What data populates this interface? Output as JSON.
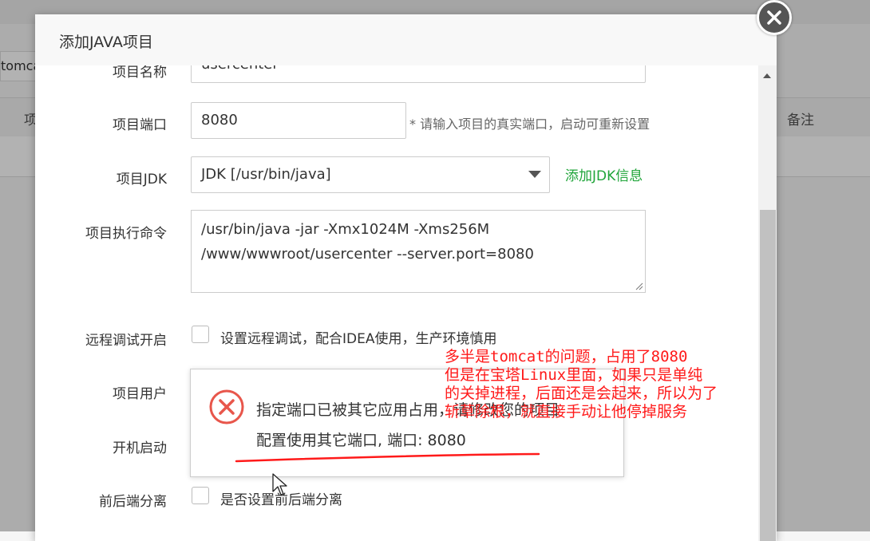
{
  "background": {
    "filter_value": "tomcat",
    "table_headers": [
      "项",
      "备注"
    ]
  },
  "dialog": {
    "title": "添加JAVA项目",
    "fields": {
      "project_name": {
        "label": "项目名称",
        "value": "usercenter"
      },
      "project_port": {
        "label": "项目端口",
        "value": "8080",
        "hint": "* 请输入项目的真实端口，启动可重新设置"
      },
      "project_jdk": {
        "label": "项目JDK",
        "value": "JDK [/usr/bin/java]",
        "add_link": "添加JDK信息"
      },
      "exec_command": {
        "label": "项目执行命令",
        "line1": "/usr/bin/java -jar -Xmx1024M -Xms256M",
        "line2": "/www/wwwroot/usercenter --server.port=8080"
      },
      "remote_debug": {
        "label": "远程调试开启",
        "text": "设置远程调试，配合IDEA使用，生产环境慎用"
      },
      "project_user": {
        "label": "项目用户"
      },
      "auto_start": {
        "label": "开机启动"
      },
      "separation": {
        "label": "前后端分离",
        "text": "是否设置前后端分离"
      }
    }
  },
  "error_message": {
    "icon": "error-circle-icon",
    "line1": "指定端口已被其它应用占用，请修改您的项目",
    "line2": "配置使用其它端口, 端口: 8080"
  },
  "annotation": {
    "lines": [
      "多半是tomcat的问题，占用了8080",
      "但是在宝塔Linux里面，如果只是单纯",
      "的关掉进程，后面还是会起来，所以为了",
      "斩草除根，就直接手动让他停掉服务"
    ],
    "color": "#ff1a1a"
  },
  "colors": {
    "accent_green": "#20a53a"
  }
}
